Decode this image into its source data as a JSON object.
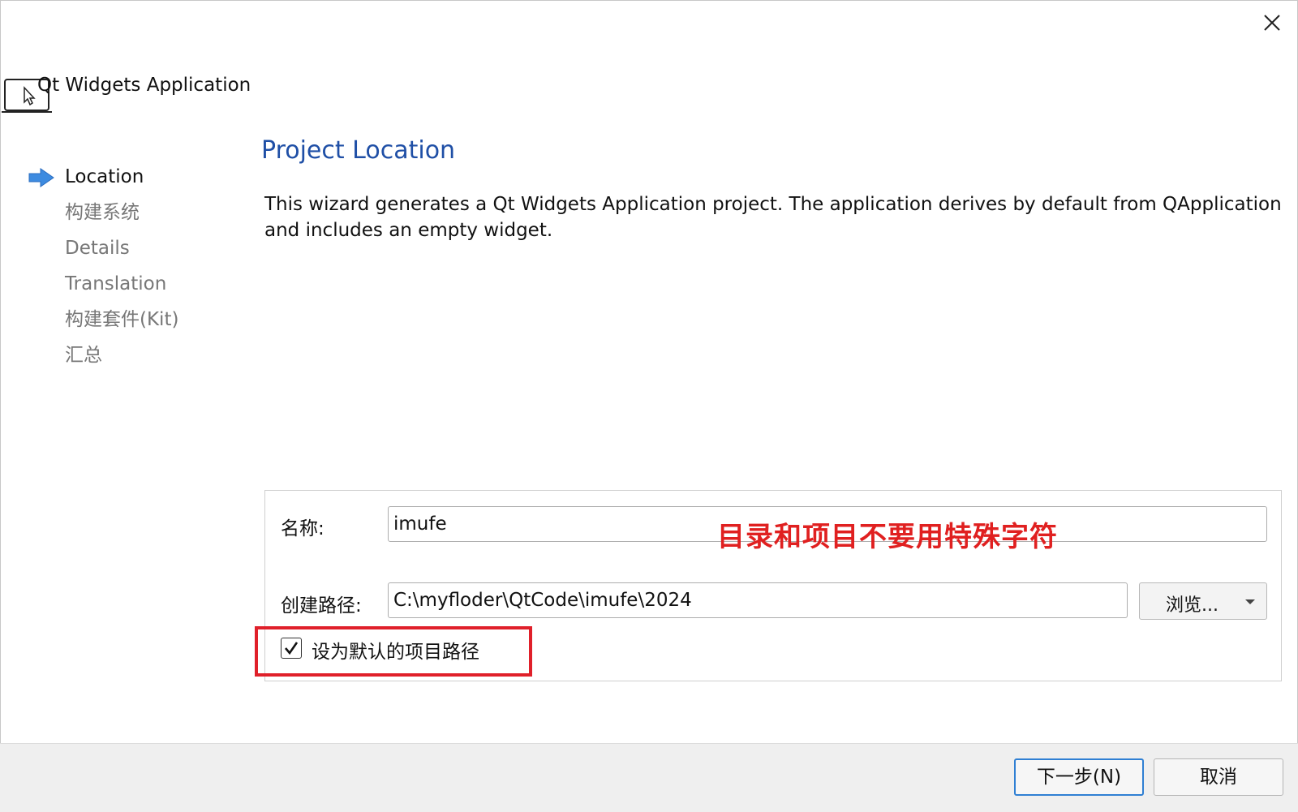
{
  "window": {
    "close_icon": "close-icon"
  },
  "header": {
    "app_icon": "application-window-cursor-icon",
    "title": "Qt Widgets Application"
  },
  "steps": [
    {
      "label": "Location",
      "active": true
    },
    {
      "label": "构建系统",
      "active": false
    },
    {
      "label": "Details",
      "active": false
    },
    {
      "label": "Translation",
      "active": false
    },
    {
      "label": "构建套件(Kit)",
      "active": false
    },
    {
      "label": "汇总",
      "active": false
    }
  ],
  "main": {
    "title": "Project Location",
    "description": "This wizard generates a Qt Widgets Application project. The application derives by default from QApplication and includes an empty widget."
  },
  "form": {
    "name_label": "名称:",
    "name_value": "imufe",
    "path_label": "创建路径:",
    "path_value": "C:\\myfloder\\QtCode\\imufe\\2024",
    "browse_label": "浏览...",
    "default_path_checked": true,
    "default_path_label": "设为默认的项目路径"
  },
  "annotation": {
    "text": "目录和项目不要用特殊字符",
    "color": "#e02020"
  },
  "footer": {
    "next_label": "下一步(N)",
    "cancel_label": "取消"
  },
  "colors": {
    "title": "#1f4fa6",
    "primary_border": "#2f7fd3",
    "highlight": "#e0202a"
  }
}
